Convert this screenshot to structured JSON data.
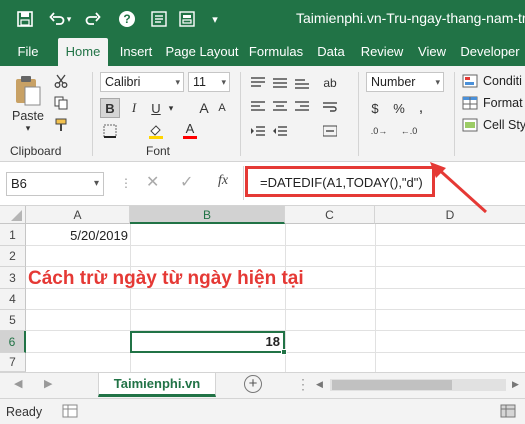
{
  "title_bar": {
    "title": "Taimienphi.vn-Tru-ngay-thang-nam-trong Excel.xlsx",
    "accent_color": "#217346",
    "icons": [
      "save-icon",
      "undo-icon",
      "redo-icon",
      "help-icon",
      "form-icon",
      "dropdown-icon"
    ]
  },
  "ribbon_tabs": [
    "File",
    "Home",
    "Insert",
    "Page Layout",
    "Formulas",
    "Data",
    "Review",
    "View",
    "Developer"
  ],
  "active_tab": "Home",
  "ribbon": {
    "clipboard": {
      "paste_label": "Paste",
      "group_label": "Clipboard"
    },
    "font": {
      "font_name": "Calibri",
      "font_size": "11",
      "bold": "B",
      "italic": "I",
      "underline": "U",
      "grow": "A",
      "shrink": "A",
      "font_color": "A",
      "group_label": "Font"
    },
    "number": {
      "format": "Number",
      "currency": "$",
      "percent": "%"
    },
    "styles": {
      "conditional": "Conditi",
      "format_as": "Format",
      "cell_styles": "Cell Styl"
    }
  },
  "formula_bar": {
    "name_box": "B6",
    "fx": "fx",
    "formula": "=DATEDIF(A1,TODAY(),\"d\")",
    "highlight_color": "#e53935"
  },
  "grid": {
    "columns": [
      "A",
      "B",
      "C",
      "D"
    ],
    "selected_column": "B",
    "rows": [
      "1",
      "2",
      "3",
      "4",
      "5",
      "6",
      "7"
    ],
    "selected_row": "6",
    "cells": {
      "A1": "5/20/2019",
      "B6": "18"
    },
    "caption": "Cách trừ ngày từ ngày hiện tại",
    "caption_color": "#e53935"
  },
  "sheet_tabs": {
    "active": "Taimienphi.vn"
  },
  "status": {
    "text": "Ready"
  }
}
